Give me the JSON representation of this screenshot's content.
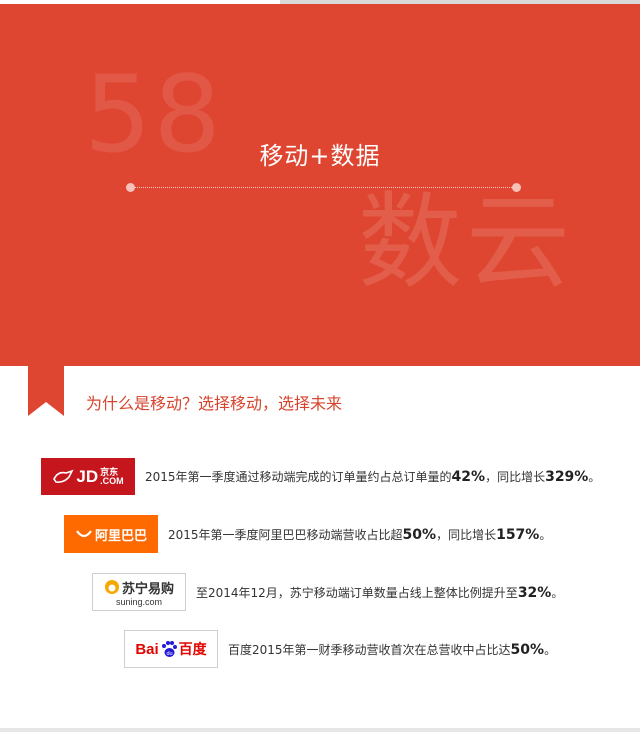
{
  "banner": {
    "watermark_number": "58",
    "watermark_text": "数云",
    "title": "移动+数据"
  },
  "section": {
    "title": "为什么是移动？选择移动，选择未来"
  },
  "items": [
    {
      "logo": {
        "text_main": "JD",
        "text_sub": ".COM",
        "text_cn": "京东"
      },
      "pre": "2015年第一季度通过移动端完成的订单量约占总订单量的",
      "v1": "42%",
      "mid": "，同比增长",
      "v2": "329%",
      "post": "。"
    },
    {
      "logo": {
        "text_main": "阿里巴巴"
      },
      "pre": "2015年第一季度阿里巴巴移动端营收占比超",
      "v1": "50%",
      "mid": "，同比增长",
      "v2": "157%",
      "post": "。"
    },
    {
      "logo": {
        "text_main": "苏宁易购",
        "text_sub": "suning.com"
      },
      "pre": "至2014年12月，苏宁移动端订单数量占线上整体比例提升至",
      "v1": "32%",
      "post": "。"
    },
    {
      "logo": {
        "text_main": "Bai",
        "text_sub": "du",
        "text_cn": "百度"
      },
      "pre": "百度2015年第一财季移动营收首次在总营收中占比达",
      "v1": "50%",
      "post": "。"
    }
  ],
  "colors": {
    "brand_red": "#df4631",
    "jd_red": "#c4161c",
    "ali_orange": "#ff6a00"
  }
}
